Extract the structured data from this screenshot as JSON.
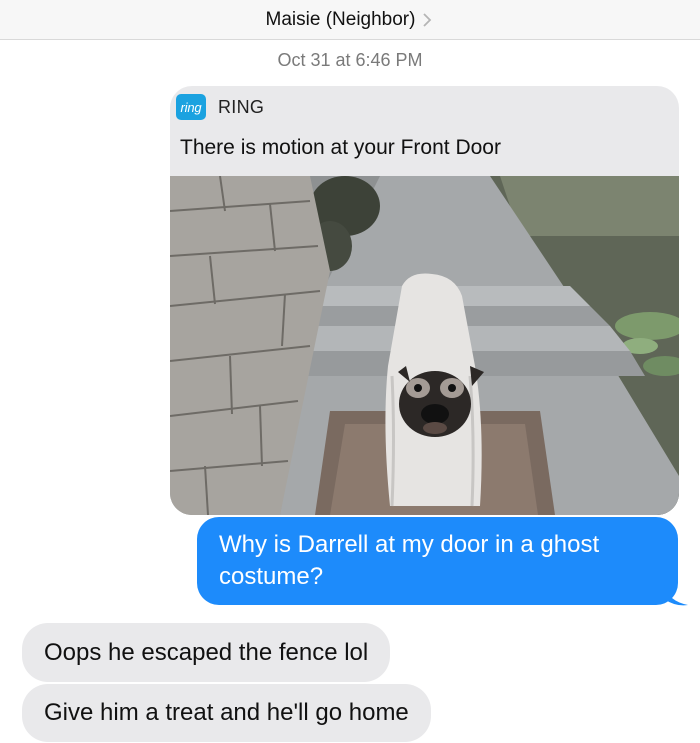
{
  "header": {
    "contact_name": "Maisie (Neighbor)",
    "chevron_icon": "chevron-right-icon"
  },
  "timestamp": "Oct 31 at 6:46 PM",
  "ring_notification": {
    "logo_text": "ring",
    "app_name": "RING",
    "message": "There is motion at your Front Door",
    "logo_color": "#1ba2e0"
  },
  "messages": {
    "outgoing_1": "Why is Darrell at my door in a ghost costume?",
    "incoming_1": "Oops he escaped the fence lol",
    "incoming_2": "Give him a treat and he'll go home"
  },
  "colors": {
    "outgoing_bubble": "#1d8bfb",
    "incoming_bubble": "#e9e9eb"
  }
}
